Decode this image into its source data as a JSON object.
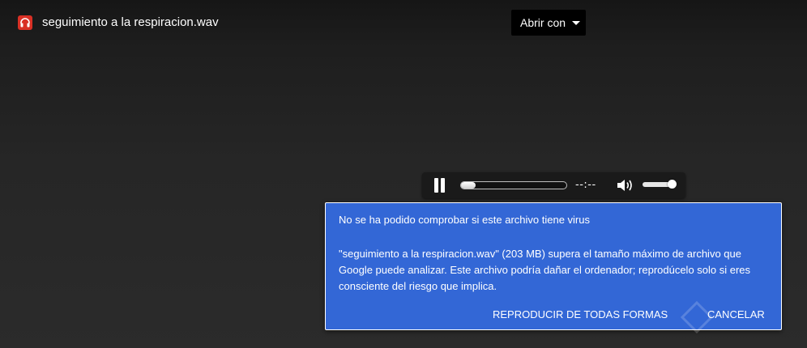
{
  "header": {
    "file_icon": "headphones-icon",
    "file_title": "seguimiento a la respiracion.wav",
    "open_with_label": "Abrir con",
    "open_with_caret": "chevron-down-icon"
  },
  "player": {
    "play_state_icon": "pause-icon",
    "time_display": "--:--",
    "seek_progress": 0.0,
    "volume_icon": "volume-icon",
    "volume_level": 0.9
  },
  "warning": {
    "title": "No se ha podido comprobar si este archivo tiene virus",
    "message": "\"seguimiento a la respiracion.wav\" (203 MB) supera el tamaño máximo de archivo que Google puede analizar. Este archivo podría dañar el ordenador; reprodúcelo solo si eres consciente del riesgo que implica.",
    "play_anyway_label": "REPRODUCIR DE TODAS FORMAS",
    "cancel_label": "CANCELAR"
  },
  "colors": {
    "background": "#2a2a2a",
    "dialog_blue": "#3367d6",
    "file_icon_red": "#d93025"
  }
}
